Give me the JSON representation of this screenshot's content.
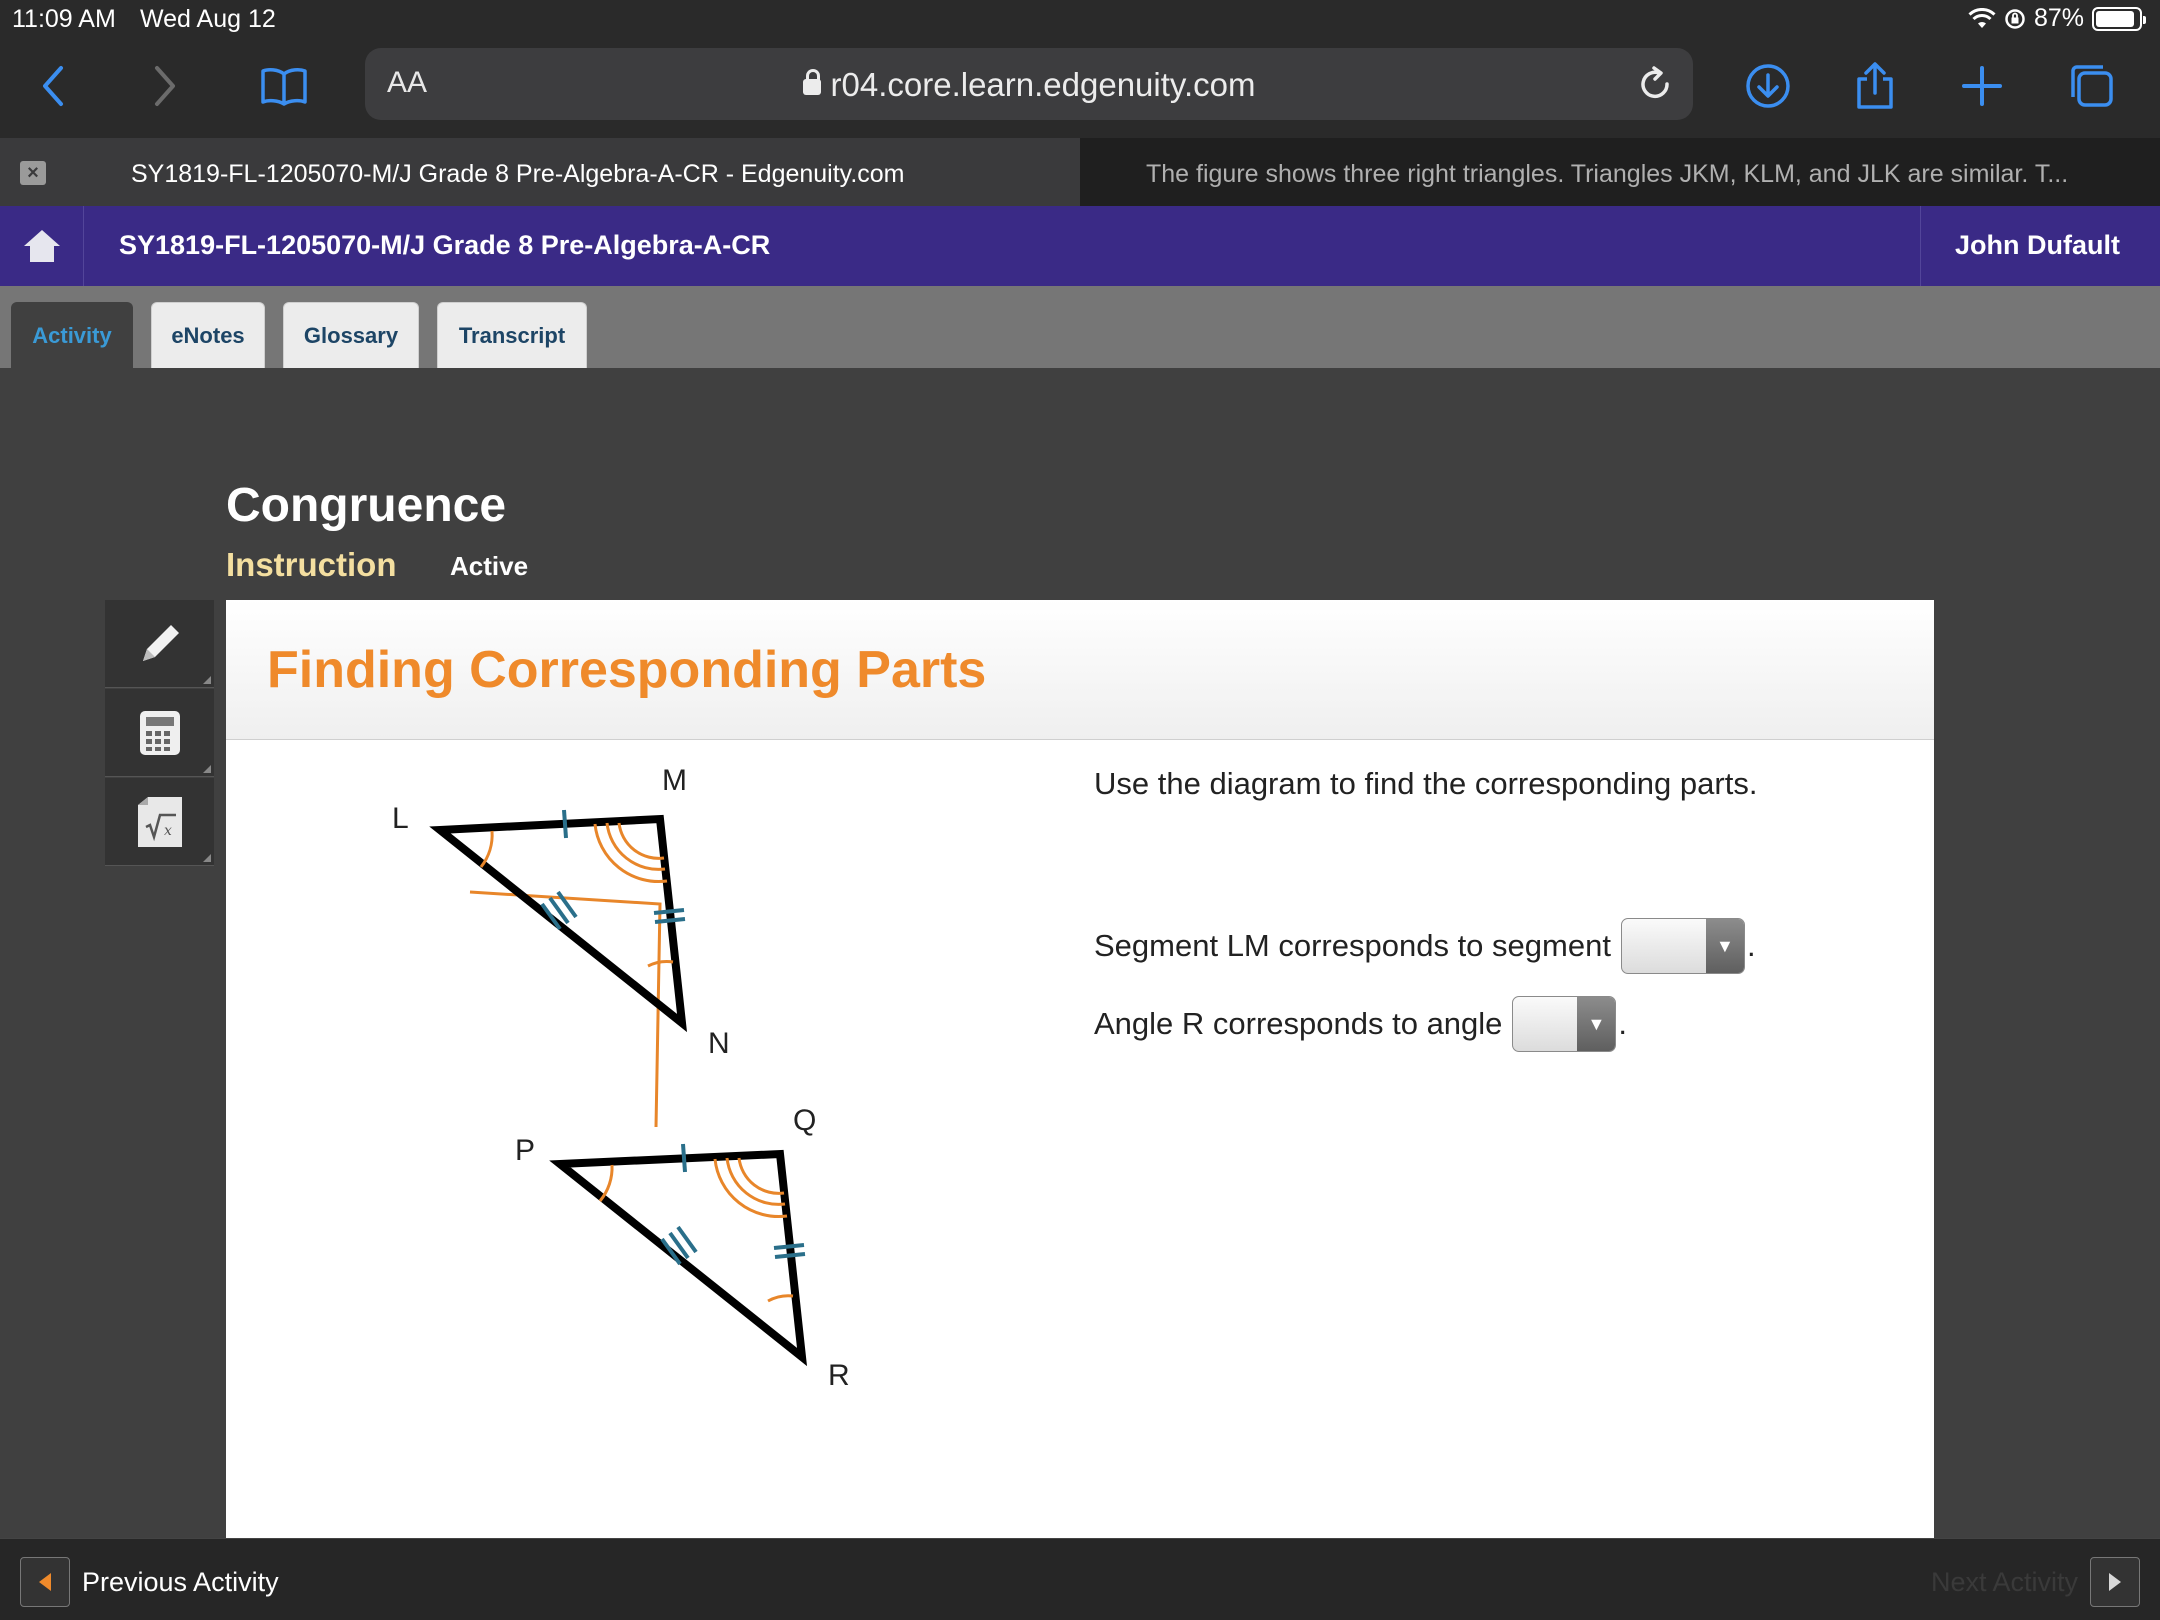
{
  "status_bar": {
    "time": "11:09 AM",
    "date": "Wed Aug 12",
    "battery": "87%"
  },
  "browser": {
    "aa_label": "AA",
    "url": "r04.core.learn.edgenuity.com",
    "tabs": [
      {
        "title": "SY1819-FL-1205070-M/J Grade 8 Pre-Algebra-A-CR - Edgenuity.com",
        "active": true
      },
      {
        "title": "The figure shows three right triangles. Triangles JKM, KLM, and JLK are similar. T...",
        "active": false
      }
    ]
  },
  "app_header": {
    "course_title": "SY1819-FL-1205070-M/J Grade 8 Pre-Algebra-A-CR",
    "user_name": "John Dufault"
  },
  "nav_tabs": [
    {
      "label": "Activity",
      "active": true
    },
    {
      "label": "eNotes",
      "active": false
    },
    {
      "label": "Glossary",
      "active": false
    },
    {
      "label": "Transcript",
      "active": false
    }
  ],
  "lesson": {
    "title": "Congruence",
    "subtitle": "Instruction",
    "status": "Active"
  },
  "tools": [
    "pencil-icon",
    "calculator-icon",
    "formula-sheet-icon"
  ],
  "panel": {
    "title": "Finding Corresponding Parts",
    "instruction": "Use the diagram to find the corresponding parts.",
    "questions": [
      {
        "text": "Segment LM corresponds to segment",
        "selected": ""
      },
      {
        "text": "Angle R corresponds to angle",
        "selected": ""
      }
    ],
    "diagram_labels": {
      "L": "L",
      "M": "M",
      "N": "N",
      "P": "P",
      "Q": "Q",
      "R": "R"
    }
  },
  "footer": {
    "prev_label": "Previous Activity",
    "next_label": "Next Activity"
  },
  "colors": {
    "header_purple": "#3a2a86",
    "title_orange": "#ef8a2b",
    "active_tab_blue": "#3a9ad6",
    "browser_blue": "#3b8ef0"
  }
}
